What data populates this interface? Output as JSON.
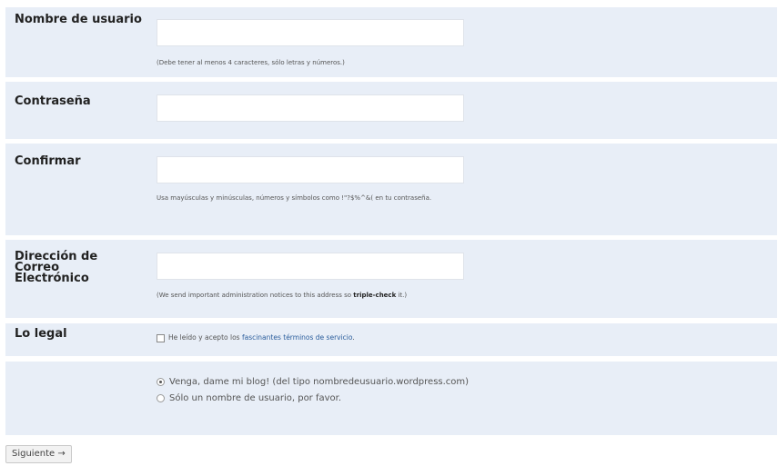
{
  "fields": {
    "username": {
      "label": "Nombre de usuario",
      "value": "",
      "hint": "(Debe tener al menos 4 caracteres, sólo letras y números.)"
    },
    "password": {
      "label": "Contraseña",
      "value": ""
    },
    "confirm": {
      "label": "Confirmar",
      "value": "",
      "hint": "Usa mayúsculas y minúsculas, números y símbolos como !\"?$%^&( en tu contraseña."
    },
    "email": {
      "label": "Dirección de Correo Electrónico",
      "value": "",
      "hint_pre": "(We send important administration notices to this address so ",
      "hint_bold": "triple-check",
      "hint_post": " it.)"
    },
    "legal": {
      "label": "Lo legal",
      "checkbox_pre": "He leído y acepto los ",
      "checkbox_link": "fascinantes términos de servicio",
      "checkbox_post": ".",
      "checked": false
    }
  },
  "blog_options": {
    "option1": "Venga, dame mi blog! (del tipo nombredeusuario.wordpress.com)",
    "option2": "Sólo un nombre de usuario, por favor.",
    "selected": "option1"
  },
  "submit_label": "Siguiente →"
}
